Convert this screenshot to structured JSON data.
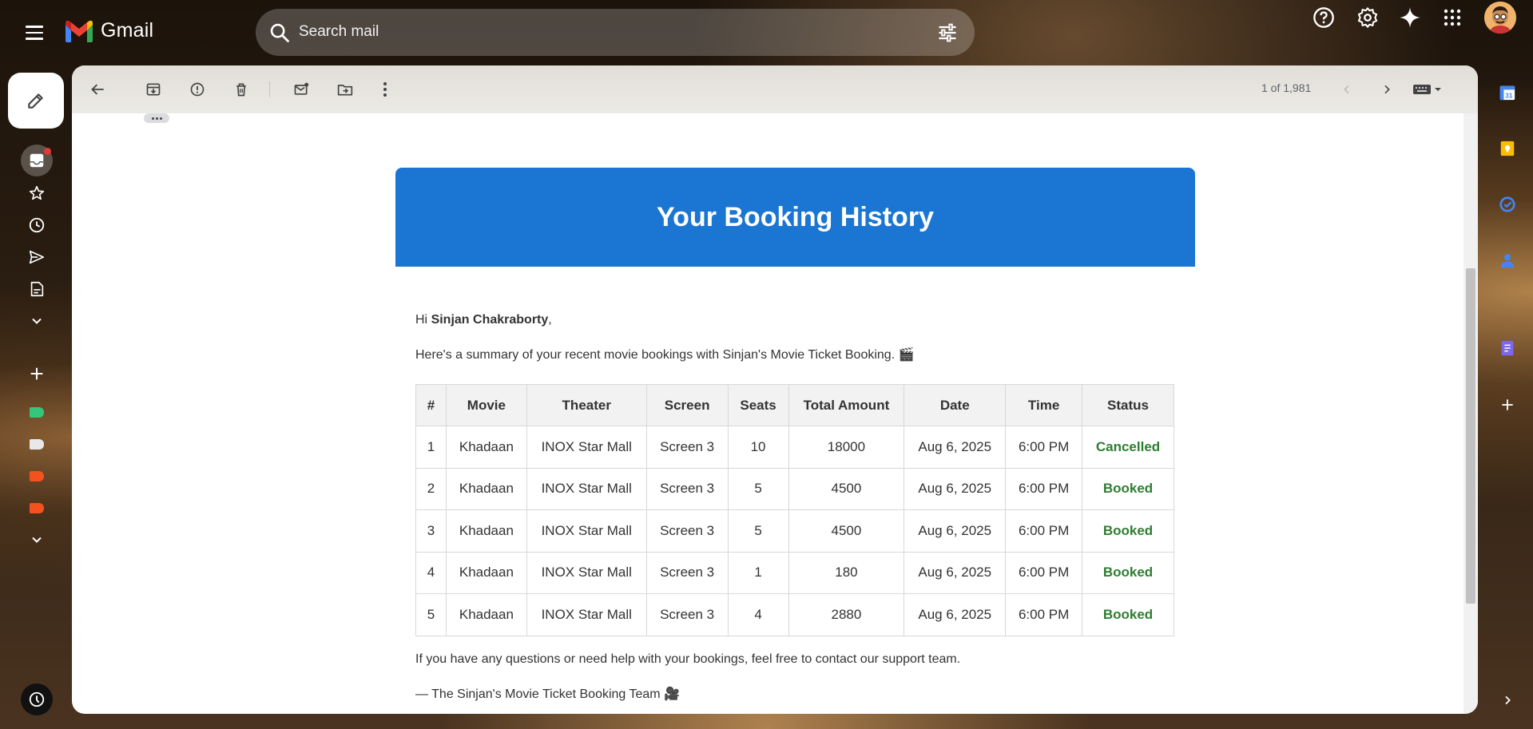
{
  "app": {
    "name": "Gmail"
  },
  "search": {
    "placeholder": "Search mail"
  },
  "toolbar": {
    "pager": "1 of 1,981"
  },
  "email": {
    "banner_title": "Your Booking History",
    "greeting_prefix": "Hi ",
    "greeting_name": "Sinjan Chakraborty",
    "greeting_suffix": ",",
    "summary": "Here's a summary of your recent movie bookings with Sinjan's Movie Ticket Booking. 🎬",
    "table": {
      "headers": [
        "#",
        "Movie",
        "Theater",
        "Screen",
        "Seats",
        "Total Amount",
        "Date",
        "Time",
        "Status"
      ],
      "rows": [
        [
          "1",
          "Khadaan",
          "INOX Star Mall",
          "Screen 3",
          "10",
          "18000",
          "Aug 6, 2025",
          "6:00 PM",
          "Cancelled"
        ],
        [
          "2",
          "Khadaan",
          "INOX Star Mall",
          "Screen 3",
          "5",
          "4500",
          "Aug 6, 2025",
          "6:00 PM",
          "Booked"
        ],
        [
          "3",
          "Khadaan",
          "INOX Star Mall",
          "Screen 3",
          "5",
          "4500",
          "Aug 6, 2025",
          "6:00 PM",
          "Booked"
        ],
        [
          "4",
          "Khadaan",
          "INOX Star Mall",
          "Screen 3",
          "1",
          "180",
          "Aug 6, 2025",
          "6:00 PM",
          "Booked"
        ],
        [
          "5",
          "Khadaan",
          "INOX Star Mall",
          "Screen 3",
          "4",
          "2880",
          "Aug 6, 2025",
          "6:00 PM",
          "Booked"
        ]
      ]
    },
    "help_text": "If you have any questions or need help with your bookings, feel free to contact our support team.",
    "signoff": "— The Sinjan's Movie Ticket Booking Team 🎥"
  },
  "colors": {
    "banner": "#1a76d2",
    "status_green": "#2e7d32",
    "label_green": "#34c77b",
    "label_white": "#e8e8e8",
    "label_red": "#f4511e"
  },
  "icons": {
    "left_rail": [
      "inbox-icon",
      "star-icon",
      "clock-icon",
      "send-icon",
      "draft-icon",
      "chevron-down-icon",
      "plus-icon"
    ],
    "right_rail": [
      "calendar-icon",
      "keep-icon",
      "tasks-icon",
      "contacts-icon",
      "forms-icon",
      "plus-icon",
      "chevron-right-icon"
    ]
  }
}
